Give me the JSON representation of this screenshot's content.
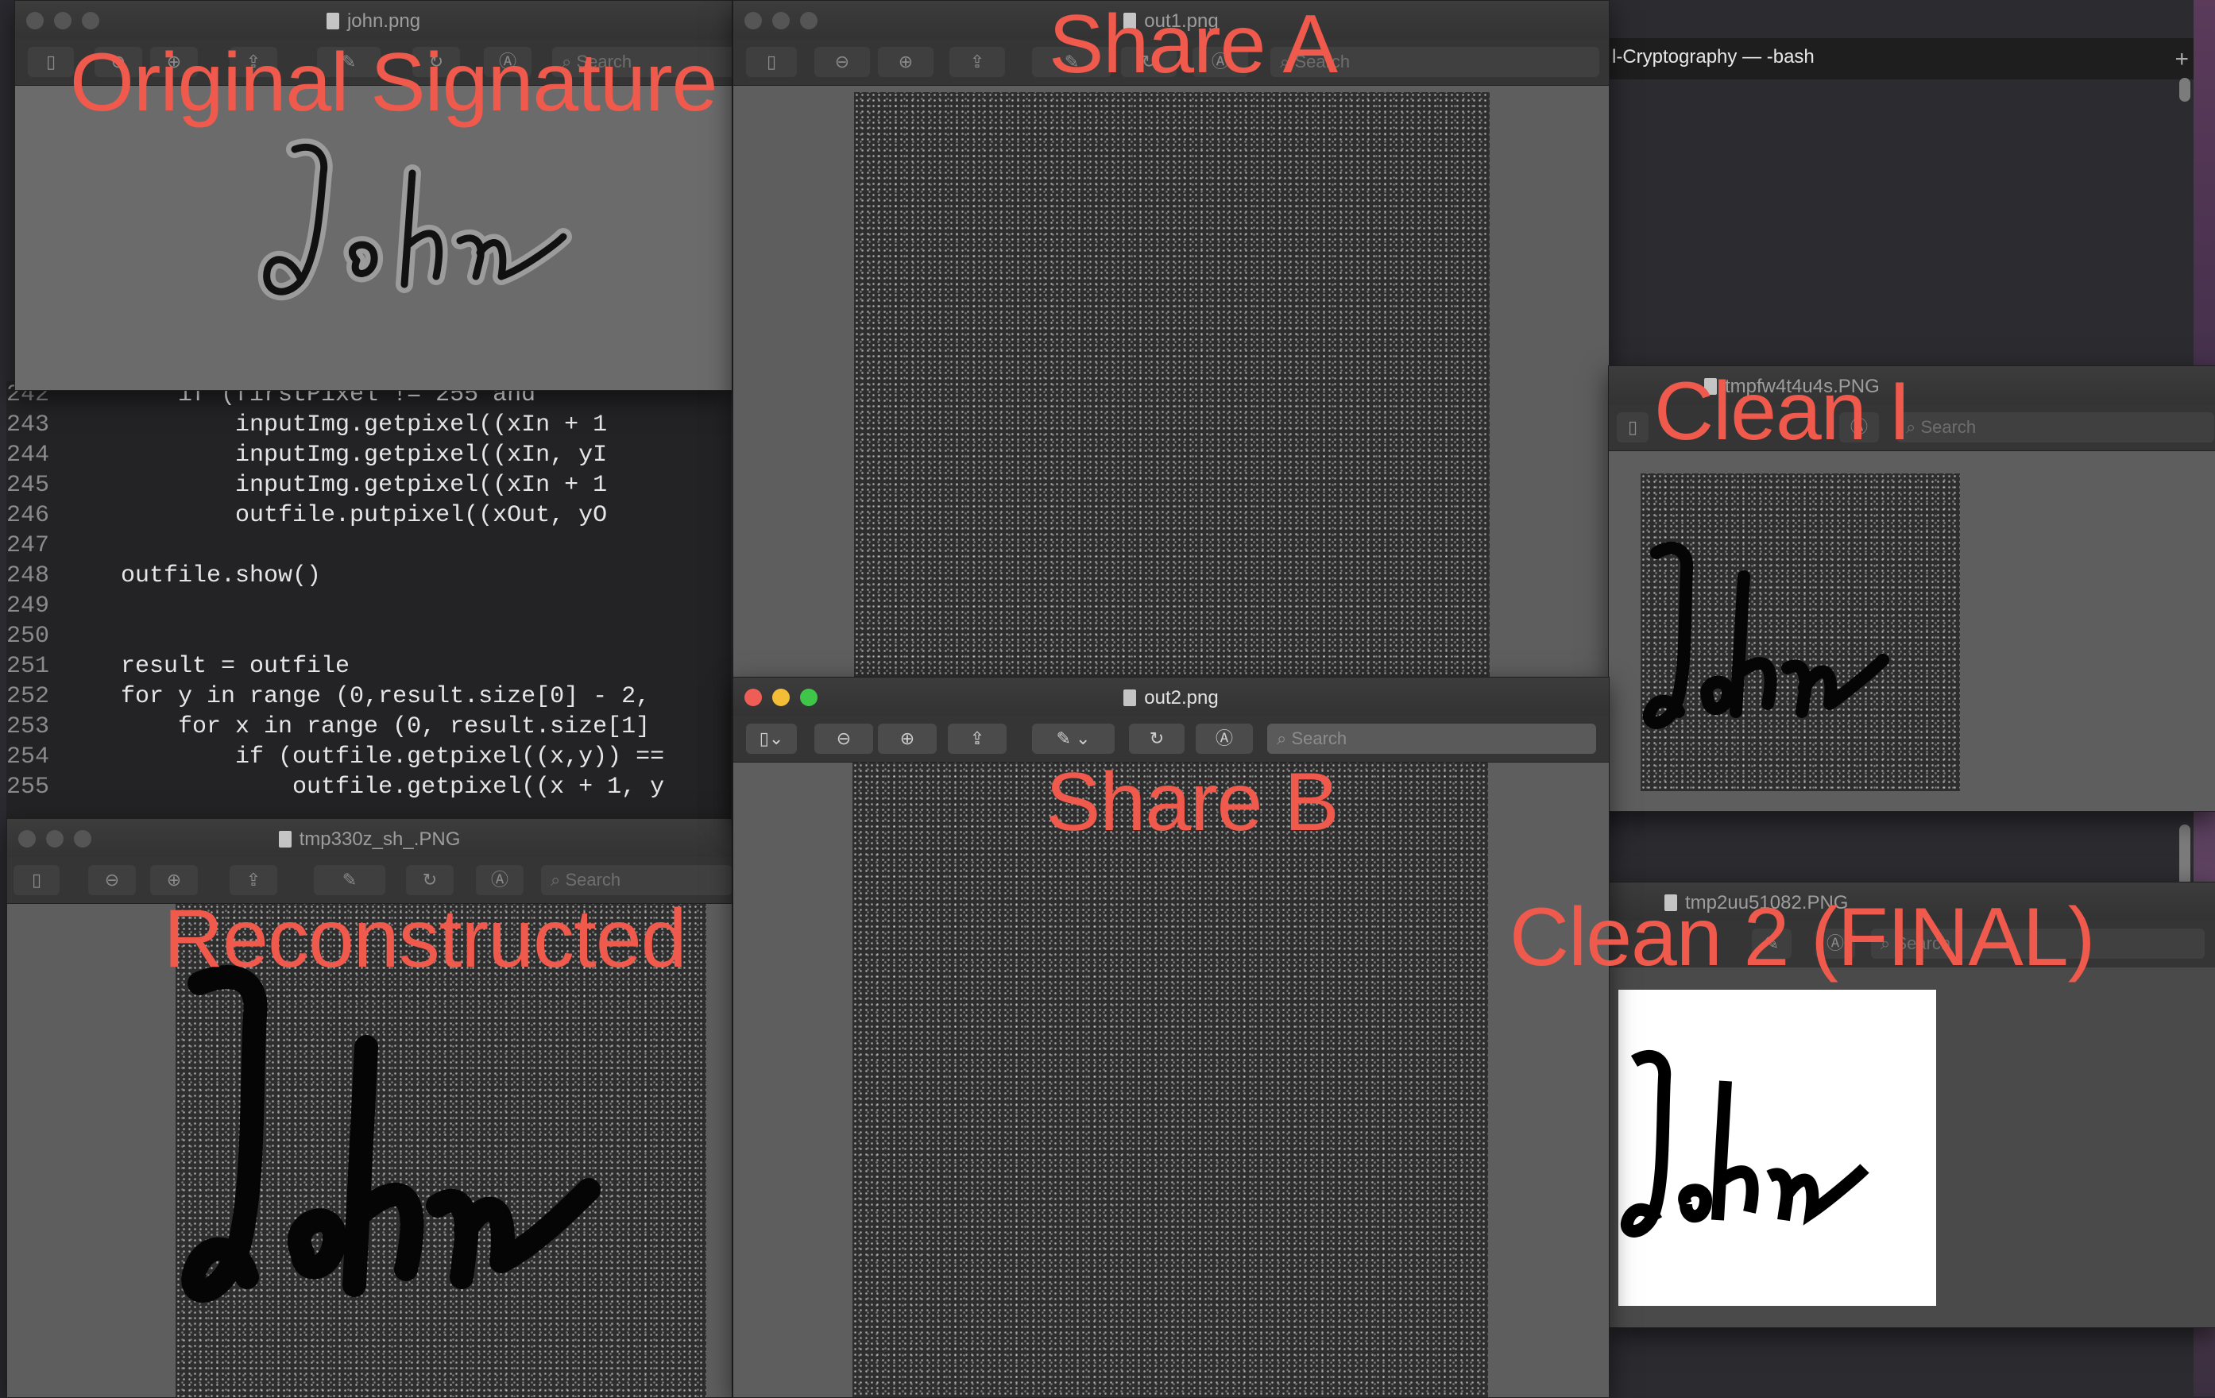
{
  "terminal": {
    "title": "l-Cryptography — -bash",
    "new_tab": "+"
  },
  "code_editor": {
    "lines": [
      {
        "num": "242",
        "text": "        if (firstPixel != 255 and"
      },
      {
        "num": "243",
        "text": "            inputImg.getpixel((xIn + 1"
      },
      {
        "num": "244",
        "text": "            inputImg.getpixel((xIn, yI"
      },
      {
        "num": "245",
        "text": "            inputImg.getpixel((xIn + 1"
      },
      {
        "num": "246",
        "text": "            outfile.putpixel((xOut, yO"
      },
      {
        "num": "247",
        "text": ""
      },
      {
        "num": "248",
        "text": "    outfile.show()"
      },
      {
        "num": "249",
        "text": ""
      },
      {
        "num": "250",
        "text": ""
      },
      {
        "num": "251",
        "text": "    result = outfile"
      },
      {
        "num": "252",
        "text": "    for y in range (0,result.size[0] - 2,"
      },
      {
        "num": "253",
        "text": "        for x in range (0, result.size[1]"
      },
      {
        "num": "254",
        "text": "            if (outfile.getpixel((x,y)) =="
      },
      {
        "num": "255",
        "text": "                outfile.getpixel((x + 1, y"
      }
    ]
  },
  "windows": {
    "john": {
      "title": "john.png",
      "search": "Search"
    },
    "out1": {
      "title": "out1.png",
      "search": "Search"
    },
    "out2": {
      "title": "out2.png",
      "search": "Search"
    },
    "tmp330": {
      "title": "tmp330z_sh_.PNG",
      "search": "Search"
    },
    "tmpfw": {
      "title": "tmpfw4t4u4s.PNG",
      "search": "Search"
    },
    "tmp2uu": {
      "title": "tmp2uu51082.PNG",
      "search": "Search"
    }
  },
  "signature_text": "John",
  "labels": {
    "original": "Original Signature",
    "share_a": "Share A",
    "share_b": "Share B",
    "clean1": "Clean I",
    "clean2": "Clean 2 (FINAL)",
    "reconstructed": "Reconstructed"
  },
  "icons": {
    "sidebar": "sidebar-toggle-icon",
    "zoom_out": "zoom-out-icon",
    "zoom_in": "zoom-in-icon",
    "share": "share-icon",
    "markup": "markup-pen-icon",
    "rotate": "rotate-icon",
    "annotate": "annotate-icon",
    "search": "search-icon"
  },
  "colors": {
    "label": "#ef5a4c",
    "traffic_red": "#ee5e56",
    "traffic_yellow": "#f4bd37",
    "traffic_green": "#3fc64a"
  }
}
